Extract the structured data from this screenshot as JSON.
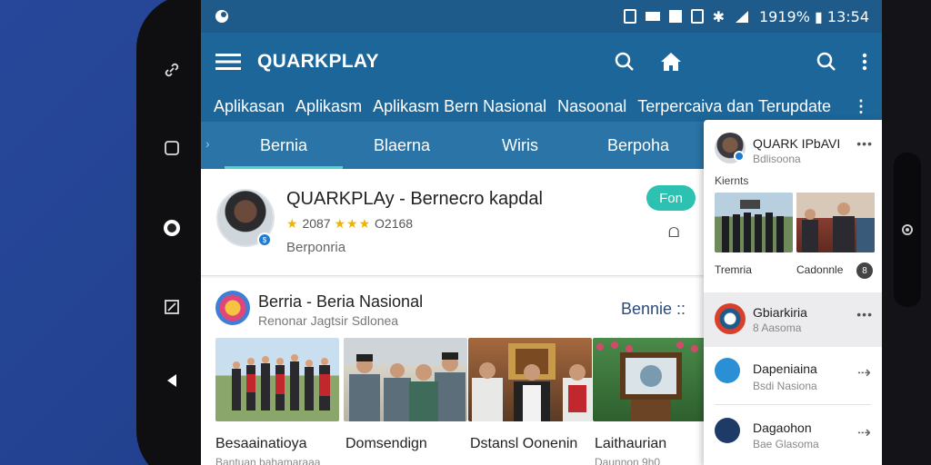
{
  "statusbar": {
    "time_battery": "1919% ▮ 13:54"
  },
  "appbar": {
    "title": "QUARKPLAY"
  },
  "subbar": {
    "items": [
      "Aplikasan",
      "Aplikasm",
      "Aplikasm Bern Nasional",
      "Nasoonal",
      "Terpercaiva dan Terupdate"
    ]
  },
  "tabs": [
    "Bernia",
    "Blaerna",
    "Wiris",
    "Berpoha"
  ],
  "card1": {
    "title": "QUARKPLAy - Bernecro kapdal",
    "rating": "2087",
    "stars": "★★★",
    "count": "O2168",
    "subtitle": "Berponria",
    "open_label": "Fon",
    "side_icon": "ᗝ"
  },
  "card2": {
    "title": "Berria - Beria Nasional",
    "subtitle": "Renonar Jagtsir Sdlonea",
    "more_label": "Bennie ::",
    "items": [
      {
        "caption": "Besaainatioya",
        "sub": "Bantuan bahamaraaa"
      },
      {
        "caption": "Domsendign",
        "sub": ""
      },
      {
        "caption": "Dstansl Oonenin",
        "sub": ""
      },
      {
        "caption": "Laithaurian",
        "sub": "Daunnon 9h0"
      }
    ]
  },
  "panel": {
    "header": {
      "title": "QUARK IPbAVI",
      "sub": "Bdlisoona"
    },
    "section_label": "Kiernts",
    "images": [
      {
        "caption": "Tremria"
      },
      {
        "caption": "Cadonnle"
      }
    ],
    "count": "8",
    "rows": [
      {
        "title": "Gbiarkiria",
        "sub": "8 Aasoma"
      },
      {
        "title": "Dapeniaina",
        "sub": "Bsdi Nasiona"
      },
      {
        "title": "Dagaohon",
        "sub": "Bae Glasoma"
      }
    ]
  },
  "colors": {
    "appbar": "#1d6699",
    "statusbar": "#1f5b8a",
    "accent": "#2cc1b0",
    "background": "#22418f"
  }
}
